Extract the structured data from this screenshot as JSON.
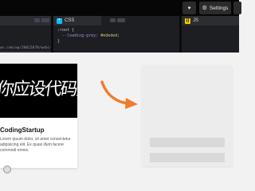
{
  "toolbar": {
    "heart_icon": "heart-icon",
    "settings_label": "Settings",
    "settings_icon": "gear-icon"
  },
  "editors": {
    "css": {
      "tab_label": "CSS",
      "badge": "CSS"
    },
    "js": {
      "tab_label": "JS",
      "badge": "JS"
    },
    "left": {
      "url_fragment": "ws.com/wp/20022070/webc-"
    },
    "css_code": {
      "line1": ":root {",
      "property": "--loading-grey:",
      "value": "#ededed;",
      "line3": "}"
    }
  },
  "preview": {
    "card": {
      "image_text": "你应设代码开发",
      "title": "CodingStartup",
      "body": "Lorem ipsum dolor, sit amet consectetur adipisicing elit. Ex quasi illum facere commodi omnis."
    },
    "arrow_color": "#f07c2a"
  },
  "colors": {
    "topbar": "#060606",
    "editor_bg": "#1d1e22",
    "accent_orange": "#f07c2a",
    "css_badge": "#0ebeff",
    "js_badge": "#fcd000"
  }
}
